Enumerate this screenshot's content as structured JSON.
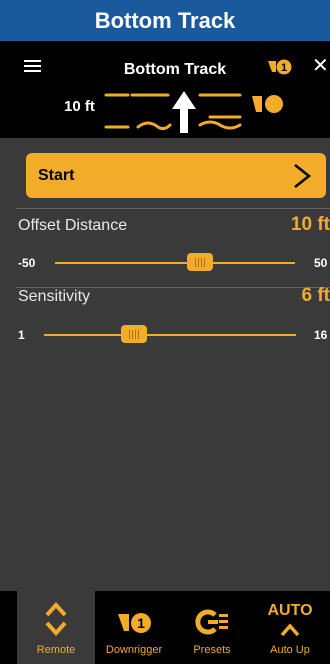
{
  "title_bar": {
    "title": "Bottom Track"
  },
  "header": {
    "title": "Bottom Track",
    "depth": "10 ft",
    "badge_number": "1",
    "menu_icon": "hamburger-menu-icon",
    "close_icon": "close-icon"
  },
  "start_button": {
    "label": "Start",
    "icon": "chevron-right-icon"
  },
  "settings": [
    {
      "label": "Offset Distance",
      "value": "10 ft",
      "min": "-50",
      "max": "50",
      "level": 10
    },
    {
      "label": "Sensitivity",
      "value": "6 ft",
      "min": "1",
      "max": "16",
      "level": 6
    }
  ],
  "bottom_nav": [
    {
      "label": "Remote",
      "icon": "up-down-chevrons-icon",
      "active": true
    },
    {
      "label": "Downrigger",
      "icon": "downrigger-1-icon",
      "active": false
    },
    {
      "label": "Presets",
      "icon": "presets-icon",
      "active": false
    },
    {
      "label": "Auto Up",
      "icon": "auto-up-icon",
      "active": false,
      "auto_text": "AUTO"
    }
  ],
  "colors": {
    "accent": "#f2ac2a",
    "title_bar": "#1a5a9c",
    "background": "#3a3a3a",
    "header": "#000000"
  }
}
